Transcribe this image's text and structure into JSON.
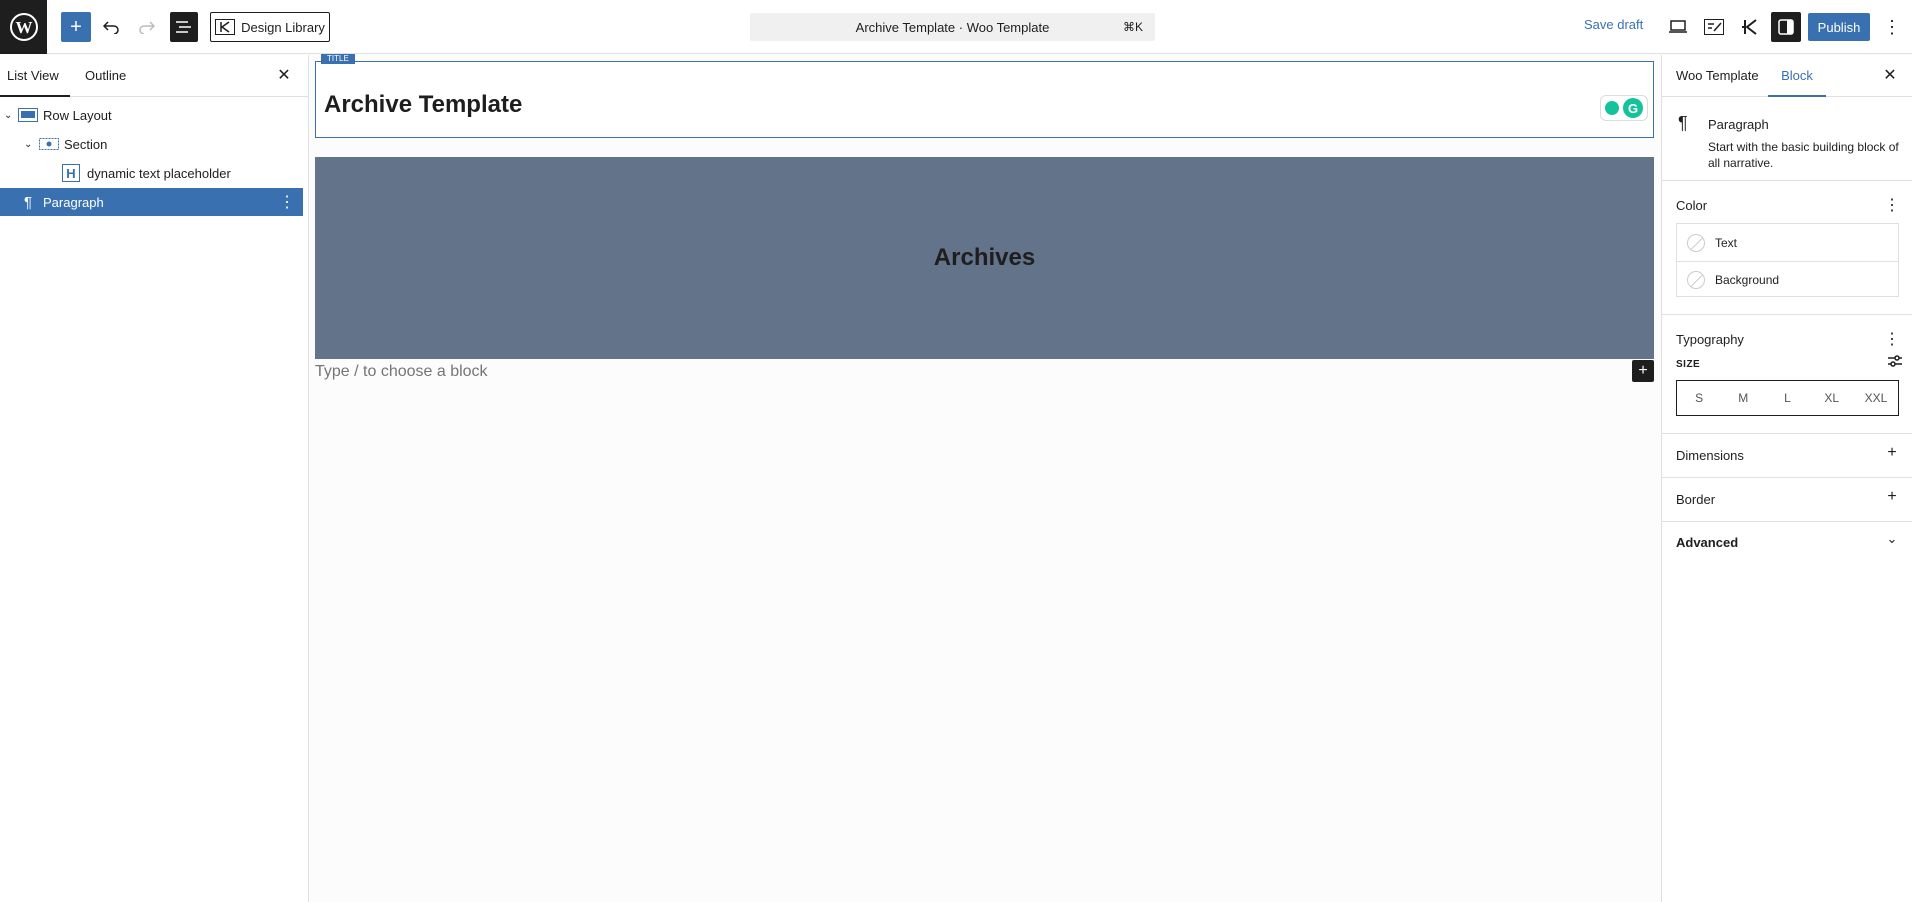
{
  "header": {
    "design_library": "Design Library",
    "command_title": "Archive Template · Woo Template",
    "command_shortcut": "⌘K",
    "save_draft": "Save draft",
    "publish": "Publish"
  },
  "left_panel": {
    "tabs": [
      "List View",
      "Outline"
    ],
    "tree": [
      {
        "label": "Row Layout",
        "icon": "row-layout-icon"
      },
      {
        "label": "Section",
        "icon": "section-icon"
      },
      {
        "label": "dynamic text placeholder",
        "icon": "heading-icon"
      },
      {
        "label": "Paragraph",
        "icon": "paragraph-icon"
      }
    ]
  },
  "canvas": {
    "title_tag": "TITLE",
    "title": "Archive Template",
    "hero_text": "Archives",
    "placeholder": "Type / to choose a block",
    "hero_color": "#637389"
  },
  "right_panel": {
    "tabs": [
      "Woo Template",
      "Block"
    ],
    "block": {
      "name": "Paragraph",
      "description": "Start with the basic building block of all narrative."
    },
    "color": {
      "title": "Color",
      "items": [
        "Text",
        "Background"
      ]
    },
    "typography": {
      "title": "Typography",
      "size_label": "SIZE",
      "sizes": [
        "S",
        "M",
        "L",
        "XL",
        "XXL"
      ]
    },
    "dimensions": "Dimensions",
    "border": "Border",
    "advanced": "Advanced"
  },
  "colors": {
    "accent": "#3971b0",
    "dark": "#1e1e1e"
  }
}
